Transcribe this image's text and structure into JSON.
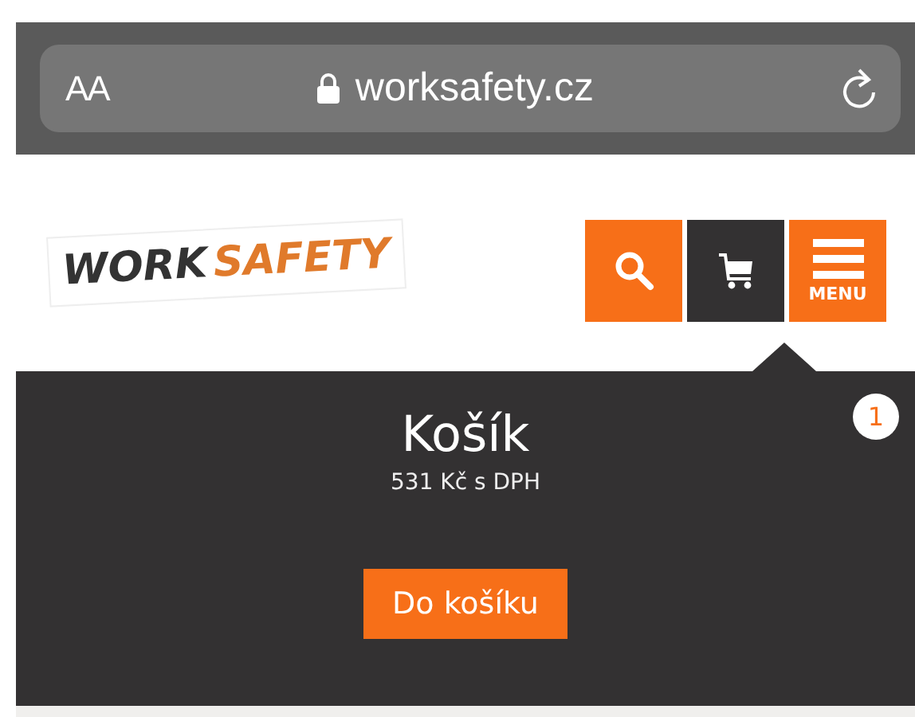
{
  "browser_bar": {
    "text_size_label": "AA",
    "url": "worksafety.cz"
  },
  "logo": {
    "part_1": "WORK",
    "part_2": "SAFETY"
  },
  "header_buttons": [
    {
      "kind": "search",
      "selected": false
    },
    {
      "kind": "cart",
      "selected": true
    },
    {
      "kind": "menu",
      "label": "MENU",
      "selected": false
    }
  ],
  "cart_panel": {
    "title": "Košík",
    "price": "531 Kč s DPH",
    "count": "1",
    "button": "Do košíku"
  }
}
